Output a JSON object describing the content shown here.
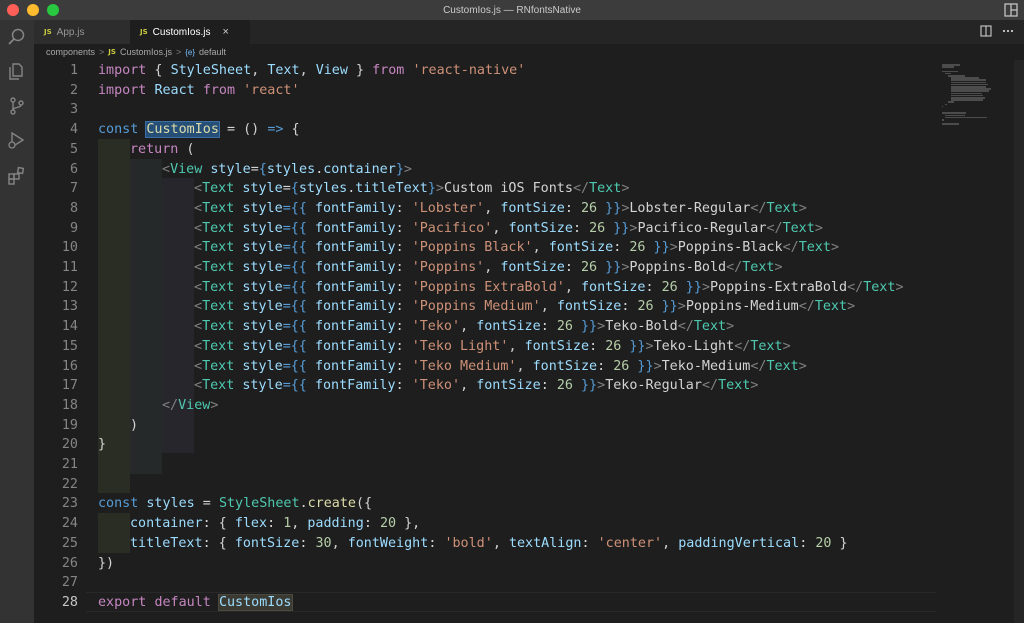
{
  "window": {
    "title": "CustomIos.js — RNfontsNative"
  },
  "tabs": [
    {
      "icon": "JS",
      "label": "App.js"
    },
    {
      "icon": "JS",
      "label": "CustomIos.js",
      "close": "×"
    }
  ],
  "breadcrumb": {
    "folder": "components",
    "file_icon": "JS",
    "file": "CustomIos.js",
    "symbol_icon": "{e}",
    "symbol": "default",
    "separator": ">"
  },
  "editor": {
    "active_line": 28,
    "lines": [
      {
        "n": "1"
      },
      {
        "n": "2"
      },
      {
        "n": "3"
      },
      {
        "n": "4"
      },
      {
        "n": "5"
      },
      {
        "n": "6"
      },
      {
        "n": "7"
      },
      {
        "n": "8"
      },
      {
        "n": "9"
      },
      {
        "n": "10"
      },
      {
        "n": "11"
      },
      {
        "n": "12"
      },
      {
        "n": "13"
      },
      {
        "n": "14"
      },
      {
        "n": "15"
      },
      {
        "n": "16"
      },
      {
        "n": "17"
      },
      {
        "n": "18"
      },
      {
        "n": "19"
      },
      {
        "n": "20"
      },
      {
        "n": "21"
      },
      {
        "n": "22"
      },
      {
        "n": "23"
      },
      {
        "n": "24"
      },
      {
        "n": "25"
      },
      {
        "n": "26"
      },
      {
        "n": "27"
      },
      {
        "n": "28"
      }
    ],
    "code": {
      "l1": {
        "a": "import",
        "b": " { ",
        "c": "StyleSheet",
        "d": ", ",
        "e": "Text",
        "f": ", ",
        "g": "View",
        "h": " } ",
        "i": "from",
        "j": " ",
        "k": "'react-native'"
      },
      "l2": {
        "a": "import",
        "b": " ",
        "c": "React",
        "d": " ",
        "e": "from",
        "f": " ",
        "g": "'react'"
      },
      "l4": {
        "a": "const",
        "b": " ",
        "c": "CustomIos",
        "d": " = () ",
        "e": "=>",
        "f": " {"
      },
      "l5": {
        "a": "return",
        "b": " ("
      },
      "l6": {
        "a": "<",
        "b": "View",
        "c": " ",
        "d": "style",
        "e": "=",
        "f": "{",
        "g": "styles",
        "h": ".",
        "i": "container",
        "j": "}",
        "k": ">"
      },
      "l7": {
        "a": "<",
        "b": "Text",
        "c": " ",
        "d": "style",
        "e": "=",
        "f": "{",
        "g": "styles",
        "h": ".",
        "i": "titleText",
        "j": "}",
        "k": ">",
        "l": "Custom iOS Fonts",
        "m": "</",
        "n": "Text",
        "o": ">"
      },
      "text_rows": [
        {
          "family": "'Lobster'",
          "size": "26",
          "label": "Lobster-Regular"
        },
        {
          "family": "'Pacifico'",
          "size": "26",
          "label": "Pacifico-Regular"
        },
        {
          "family": "'Poppins Black'",
          "size": "26",
          "label": "Poppins-Black"
        },
        {
          "family": "'Poppins'",
          "size": "26",
          "label": "Poppins-Bold"
        },
        {
          "family": "'Poppins ExtraBold'",
          "size": "26",
          "label": "Poppins-ExtraBold"
        },
        {
          "family": "'Poppins Medium'",
          "size": "26",
          "label": "Poppins-Medium"
        },
        {
          "family": "'Teko'",
          "size": "26",
          "label": "Teko-Bold"
        },
        {
          "family": "'Teko Light'",
          "size": "26",
          "label": "Teko-Light"
        },
        {
          "family": "'Teko Medium'",
          "size": "26",
          "label": "Teko-Medium"
        },
        {
          "family": "'Teko'",
          "size": "26",
          "label": "Teko-Regular"
        }
      ],
      "row_tokens": {
        "open": "<",
        "tag": "Text",
        "sp": " ",
        "attr": "style",
        "eq": "={{ ",
        "key1": "fontFamily",
        "colon": ": ",
        "comma": ", ",
        "key2": "fontSize",
        "close": " }}",
        "gt": ">",
        "end_open": "</",
        "end_gt": ">"
      },
      "l18": {
        "a": "</",
        "b": "View",
        "c": ">"
      },
      "l19": ")",
      "l20": "}",
      "l23": {
        "a": "const",
        "b": " ",
        "c": "styles",
        "d": " = ",
        "e": "StyleSheet",
        "f": ".",
        "g": "create",
        "h": "({"
      },
      "l24": {
        "a": "container",
        "b": ": { ",
        "c": "flex",
        "d": ": ",
        "e": "1",
        "f": ", ",
        "g": "padding",
        "h": ": ",
        "i": "20",
        "j": " },"
      },
      "l25": {
        "a": "titleText",
        "b": ": { ",
        "c": "fontSize",
        "d": ": ",
        "e": "30",
        "f": ", ",
        "g": "fontWeight",
        "h": ": ",
        "i": "'bold'",
        "j": ", ",
        "k": "textAlign",
        "l": ": ",
        "m": "'center'",
        "n": ", ",
        "o": "paddingVertical",
        "p": ": ",
        "q": "20",
        "r": " }"
      },
      "l26": "})",
      "l28": {
        "a": "export",
        "b": " ",
        "c": "default",
        "d": " ",
        "e": "CustomIos"
      }
    }
  },
  "icons": {
    "activity": [
      "search-icon",
      "explorer-icon",
      "source-control-icon",
      "run-debug-icon",
      "extensions-icon"
    ],
    "tab_actions": [
      "split-editor-icon",
      "more-actions-icon"
    ],
    "layout": "layout-icon"
  },
  "colors": {
    "keyword": "#c586c0",
    "storage": "#569cd6",
    "class": "#4ec9b0",
    "function": "#dcdcaa",
    "variable": "#9cdcfe",
    "string": "#ce9178",
    "number": "#b5cea8"
  }
}
